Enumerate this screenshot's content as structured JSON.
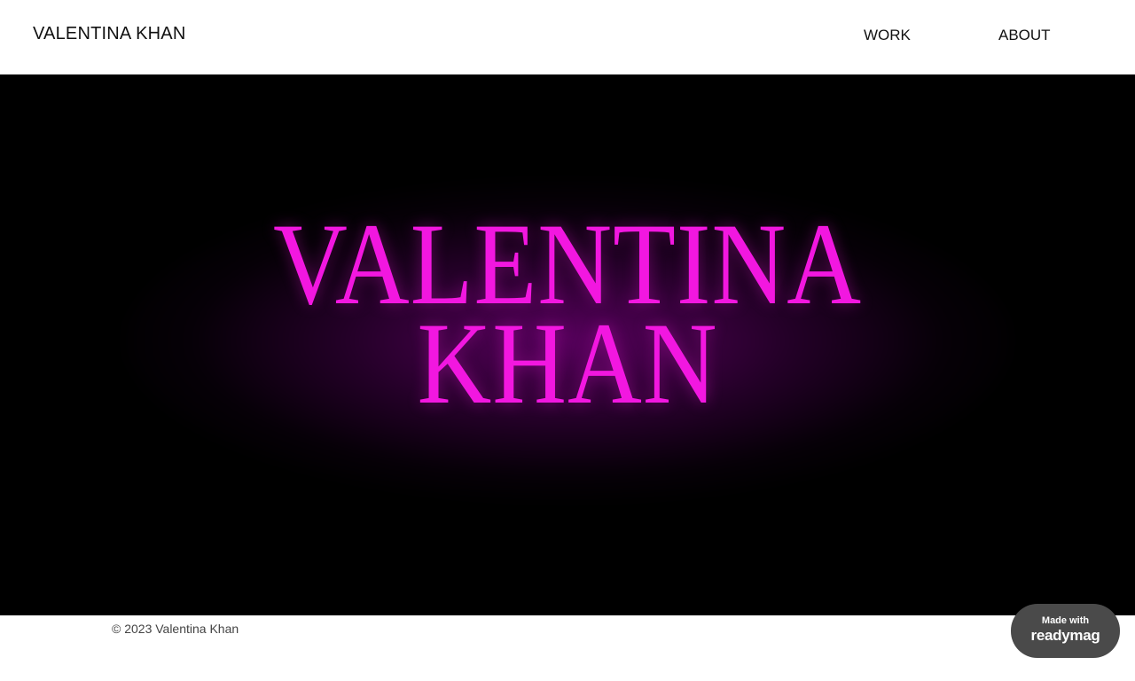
{
  "header": {
    "site_title": "VALENTINA KHAN",
    "nav": [
      {
        "label": "WORK"
      },
      {
        "label": "ABOUT"
      }
    ]
  },
  "hero": {
    "line1": "VALENTINA",
    "line2": "KHAN",
    "text_color": "#f217e0",
    "background_color": "#000000",
    "glow_color": "#a000aa"
  },
  "footer": {
    "copyright": "© 2023 Valentina Khan"
  },
  "badge": {
    "small_text": "Made with",
    "brand_text": "readymag",
    "background_color": "#4a4a4a"
  }
}
